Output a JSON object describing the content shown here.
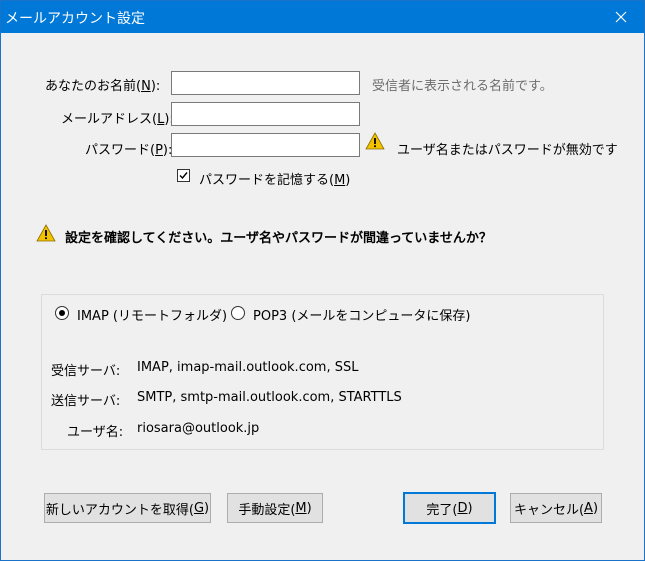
{
  "window": {
    "title": "メールアカウント設定"
  },
  "form": {
    "name_label": "あなたのお名前(",
    "name_key": "N",
    "name_label_end": "):",
    "name_value": "",
    "name_hint": "受信者に表示される名前です。",
    "email_label": "メールアドレス(",
    "email_key": "L",
    "email_label_end": "):",
    "email_value": "",
    "password_label": "パスワード(",
    "password_key": "P",
    "password_label_end": "):",
    "password_value": "",
    "password_warning": "ユーザ名またはパスワードが無効です",
    "remember_label": "パスワードを記憶する(",
    "remember_key": "M",
    "remember_label_end": ")",
    "remember_checked": true
  },
  "alert": {
    "message": "設定を確認してください。ユーザ名やパスワードが間違っていませんか？"
  },
  "server": {
    "imap_label": "IMAP (リモートフォルダ)",
    "pop3_label": "POP3 (メールをコンピュータに保存)",
    "selected": "IMAP",
    "incoming_label": "受信サーバ:",
    "incoming_value": "IMAP, imap-mail.outlook.com, SSL",
    "outgoing_label": "送信サーバ:",
    "outgoing_value": "SMTP, smtp-mail.outlook.com, STARTTLS",
    "username_label": "ユーザ名:",
    "username_value": "riosara@outlook.jp"
  },
  "buttons": {
    "new_account": "新しいアカウントを取得(",
    "new_account_key": "G",
    "new_account_end": ")",
    "manual": "手動設定(",
    "manual_key": "M",
    "manual_end": ")",
    "done": "完了(",
    "done_key": "D",
    "done_end": ")",
    "cancel": "キャンセル(",
    "cancel_key": "A",
    "cancel_end": ")"
  },
  "colors": {
    "titlebar": "#0078d7",
    "warning": "#f2c200",
    "default_button_border": "#0078d7"
  },
  "icons": {
    "close": "close-icon",
    "warning": "warning-icon",
    "check": "checkmark-icon"
  }
}
